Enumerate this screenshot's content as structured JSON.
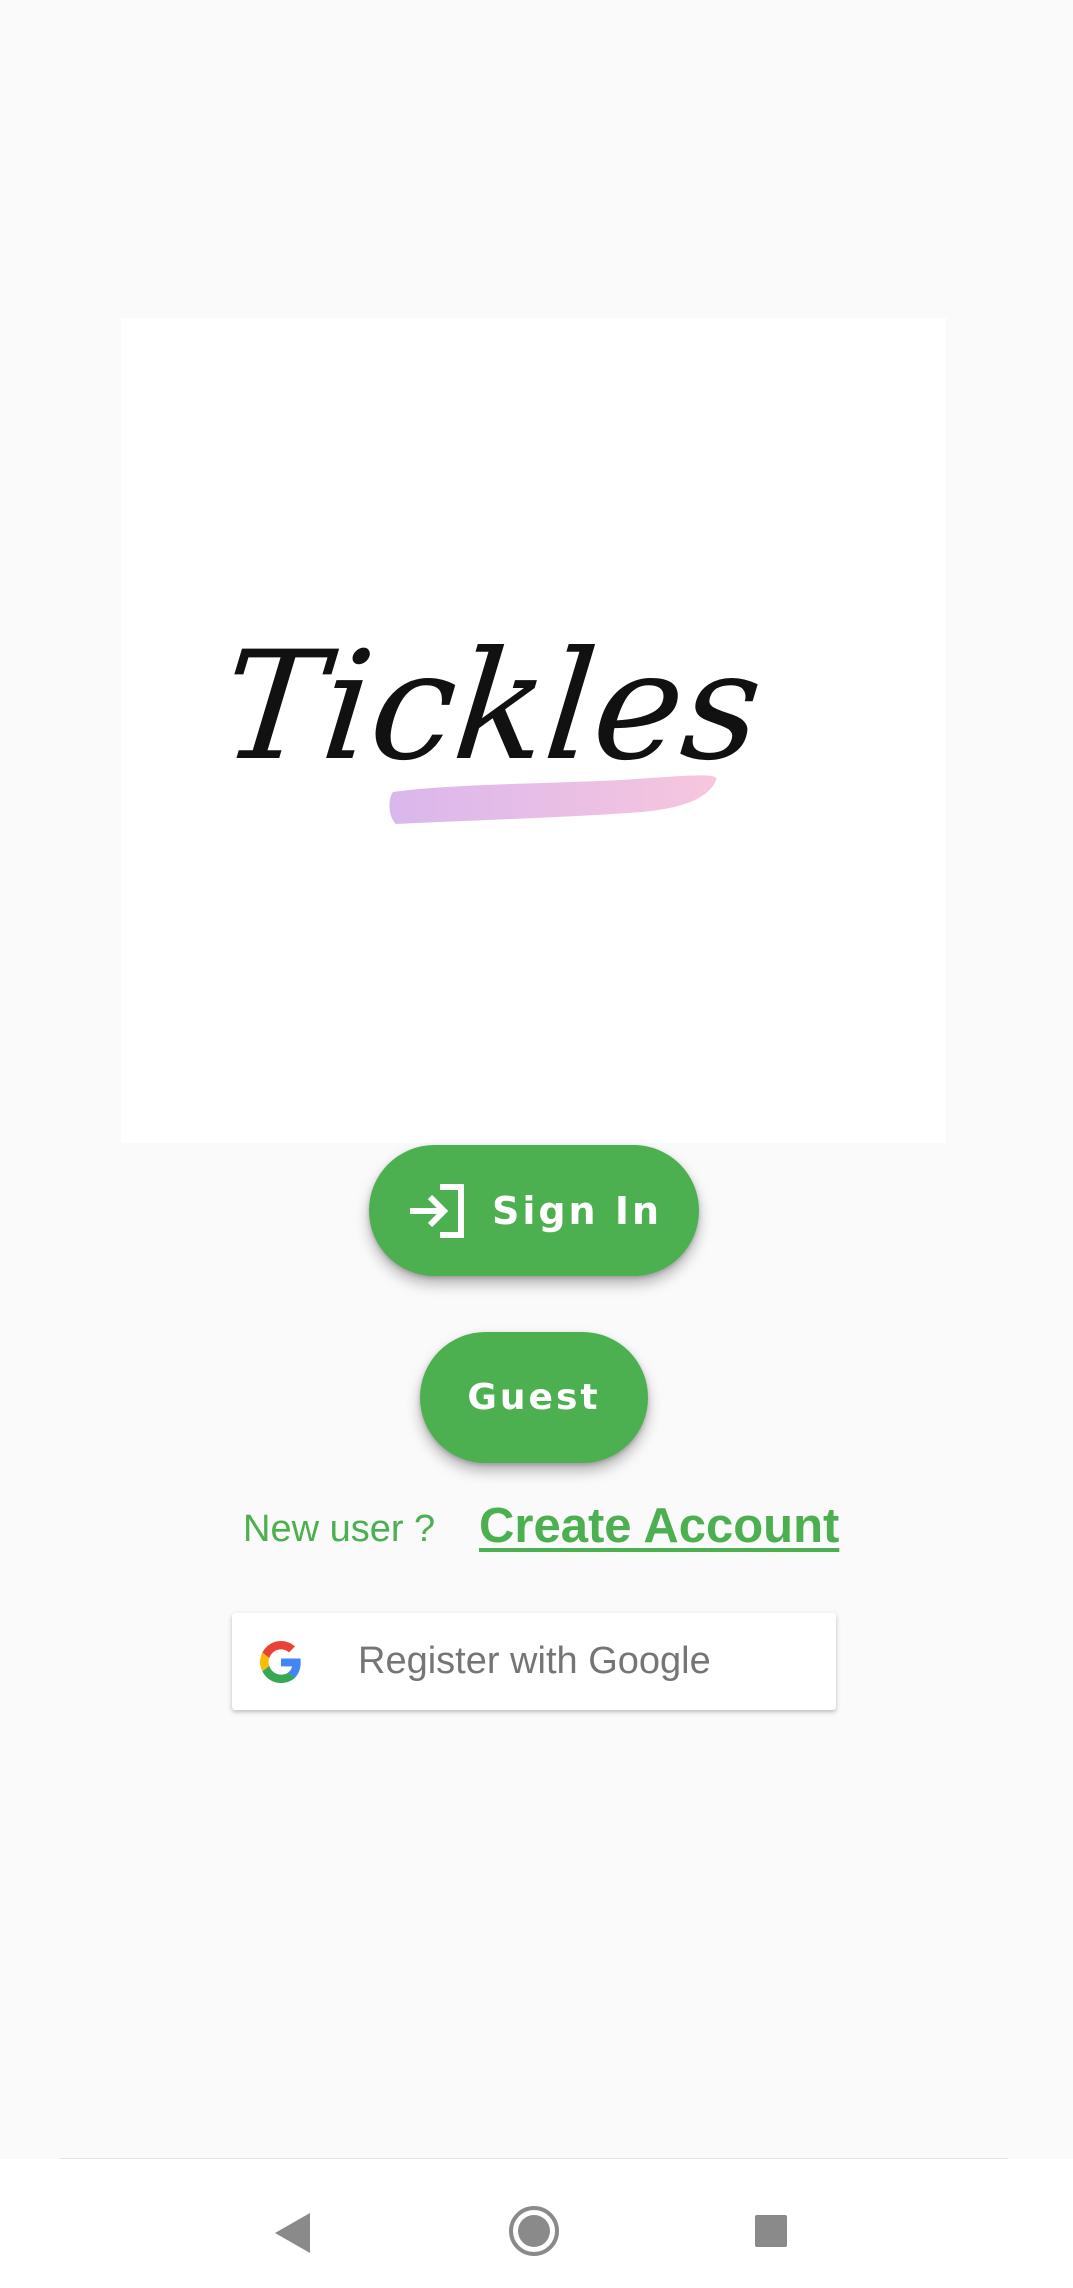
{
  "logo": {
    "text": "Tickles",
    "brush_color_start": "#d7b3ec",
    "brush_color_end": "#f7c3dc"
  },
  "buttons": {
    "sign_in_label": "Sign In",
    "sign_in_icon": "login-icon",
    "guest_label": "Guest"
  },
  "register": {
    "new_user_label": "New user ?",
    "create_account_label": "Create Account",
    "google_label": "Register with Google",
    "google_icon": "google-g-icon"
  },
  "nav": {
    "back_icon": "back-triangle-icon",
    "home_icon": "home-circle-icon",
    "recents_icon": "recents-square-icon"
  },
  "colors": {
    "accent": "#4caf50",
    "background": "#fafafa",
    "google_text": "#757575"
  }
}
